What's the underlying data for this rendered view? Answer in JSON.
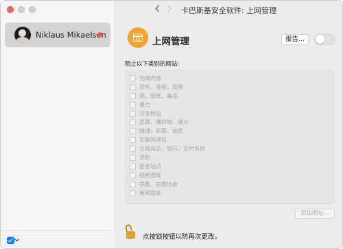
{
  "window": {
    "title": "卡巴斯基安全软件: 上网管理"
  },
  "sidebar": {
    "users": [
      {
        "name": "Niklaus Mikaelson",
        "status_color": "#f05252",
        "selected": true
      }
    ]
  },
  "main": {
    "feature_title": "上网管理",
    "report_button": "报告...",
    "toggle_on": false,
    "section_label": "阻止以下类别的网站:",
    "categories": [
      {
        "label": "色情内容",
        "checked": false
      },
      {
        "label": "软件、音频、视频",
        "checked": false
      },
      {
        "label": "酒、烟草、毒品",
        "checked": false
      },
      {
        "label": "暴力",
        "checked": false
      },
      {
        "label": "污言秽语",
        "checked": false
      },
      {
        "label": "武器、爆炸物、烟火",
        "checked": false
      },
      {
        "label": "赌博、彩票、抽奖",
        "checked": false
      },
      {
        "label": "互联网通信",
        "checked": false
      },
      {
        "label": "在线商店、银行、支付系统",
        "checked": false
      },
      {
        "label": "求职",
        "checked": false
      },
      {
        "label": "匿名站点",
        "checked": false
      },
      {
        "label": "视频游戏",
        "checked": false
      },
      {
        "label": "宗教、宗教协会",
        "checked": false
      },
      {
        "label": "新闻媒体",
        "checked": false
      }
    ],
    "add_website_button": "添加网址...",
    "lock_message": "点按锁按钮以防再次更改。"
  },
  "colors": {
    "accent_icon": "#f2a22e",
    "lock": "#d9a437",
    "checkbox_blue": "#1a7cf2"
  }
}
